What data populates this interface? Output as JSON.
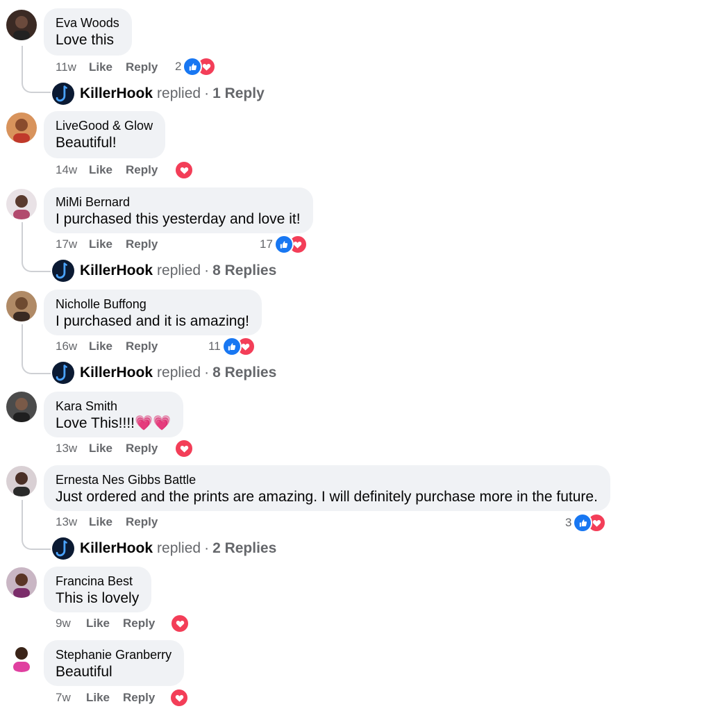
{
  "colors": {
    "like_blue": "#1877f2",
    "love_red": "#f33e58",
    "bubble_bg": "#f0f2f5",
    "muted_text": "#65676b"
  },
  "comments": [
    {
      "author": "Eva Woods",
      "text": "Love this",
      "time": "11w",
      "like": "Like",
      "reply": "Reply",
      "reaction_count": "2",
      "reactions": [
        "like-icon",
        "love-icon"
      ],
      "page_reply": {
        "name": "KillerHook",
        "verb": "replied",
        "sep": "·",
        "count": "1 Reply"
      }
    },
    {
      "author": "LiveGood & Glow",
      "text": "Beautiful!",
      "time": "14w",
      "like": "Like",
      "reply": "Reply",
      "reaction_count": "",
      "reactions": [
        "love-icon"
      ]
    },
    {
      "author": "MiMi Bernard",
      "text": "I purchased this yesterday and love it!",
      "time": "17w",
      "like": "Like",
      "reply": "Reply",
      "reaction_count": "17",
      "reactions": [
        "like-icon",
        "love-icon"
      ],
      "page_reply": {
        "name": "KillerHook",
        "verb": "replied",
        "sep": "·",
        "count": "8 Replies"
      }
    },
    {
      "author": "Nicholle Buffong",
      "text": "I purchased and it is amazing!",
      "time": "16w",
      "like": "Like",
      "reply": "Reply",
      "reaction_count": "11",
      "reactions": [
        "like-icon",
        "love-icon"
      ],
      "page_reply": {
        "name": "KillerHook",
        "verb": "replied",
        "sep": "·",
        "count": "8 Replies"
      }
    },
    {
      "author": "Kara Smith",
      "text": "Love This!!!!💗💗",
      "time": "13w",
      "like": "Like",
      "reply": "Reply",
      "reaction_count": "",
      "reactions": [
        "love-icon"
      ]
    },
    {
      "author": "Ernesta Nes Gibbs Battle",
      "text": "Just ordered and the prints are amazing. I will definitely purchase more in the future.",
      "time": "13w",
      "like": "Like",
      "reply": "Reply",
      "reaction_count": "3",
      "reactions": [
        "like-icon",
        "love-icon"
      ],
      "page_reply": {
        "name": "KillerHook",
        "verb": "replied",
        "sep": "·",
        "count": "2 Replies"
      }
    },
    {
      "author": "Francina Best",
      "text": "This is lovely",
      "time": "9w",
      "like": "Like",
      "reply": "Reply",
      "reaction_count": "",
      "reactions": [
        "love-icon"
      ]
    },
    {
      "author": "Stephanie Granberry",
      "text": "Beautiful",
      "time": "7w",
      "like": "Like",
      "reply": "Reply",
      "reaction_count": "",
      "reactions": [
        "love-icon"
      ]
    }
  ]
}
